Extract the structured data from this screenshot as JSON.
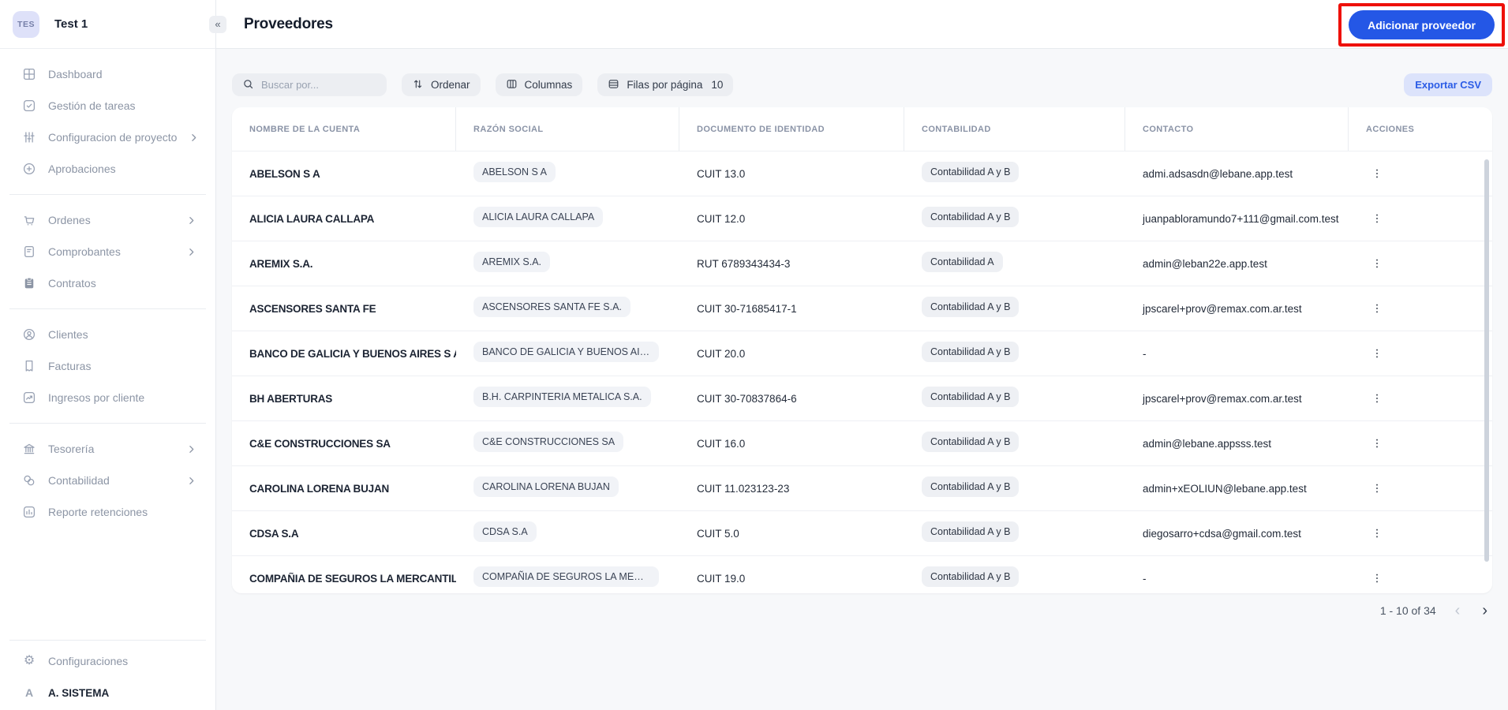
{
  "workspace": {
    "badge": "TES",
    "name": "Test 1"
  },
  "sidebar": {
    "sections": [
      {
        "items": [
          {
            "label": "Dashboard",
            "icon": "dashboard-icon",
            "expandable": false
          },
          {
            "label": "Gestión de tareas",
            "icon": "task-check-icon",
            "expandable": false
          },
          {
            "label": "Configuracion de proyecto",
            "icon": "sliders-icon",
            "expandable": true
          },
          {
            "label": "Aprobaciones",
            "icon": "plus-circle-icon",
            "expandable": false
          }
        ]
      },
      {
        "items": [
          {
            "label": "Ordenes",
            "icon": "cart-icon",
            "expandable": true
          },
          {
            "label": "Comprobantes",
            "icon": "document-icon",
            "expandable": true
          },
          {
            "label": "Contratos",
            "icon": "clipboard-icon",
            "expandable": false
          }
        ]
      },
      {
        "items": [
          {
            "label": "Clientes",
            "icon": "user-circle-icon",
            "expandable": false
          },
          {
            "label": "Facturas",
            "icon": "invoice-icon",
            "expandable": false
          },
          {
            "label": "Ingresos por cliente",
            "icon": "chart-line-icon",
            "expandable": false
          }
        ]
      },
      {
        "items": [
          {
            "label": "Tesorería",
            "icon": "bank-icon",
            "expandable": true
          },
          {
            "label": "Contabilidad",
            "icon": "coins-icon",
            "expandable": true
          },
          {
            "label": "Reporte retenciones",
            "icon": "bar-chart-icon",
            "expandable": false
          }
        ]
      }
    ],
    "footer": [
      {
        "label": "Configuraciones",
        "icon": "gear-icon",
        "expandable": false
      },
      {
        "label": "A. SISTEMA",
        "icon": "avatar-a-icon",
        "expandable": false,
        "user": true
      }
    ]
  },
  "header": {
    "collapse_icon": "«",
    "title": "Proveedores",
    "add_button_label": "Adicionar proveedor"
  },
  "toolbar": {
    "search_placeholder": "Buscar por...",
    "sort_label": "Ordenar",
    "columns_label": "Columnas",
    "rows_per_page_label": "Filas por página",
    "rows_per_page_value": "10",
    "export_label": "Exportar CSV"
  },
  "table": {
    "columns": [
      "Nombre de la cuenta",
      "Razón social",
      "Documento de identidad",
      "Contabilidad",
      "Contacto",
      "Acciones"
    ],
    "rows": [
      {
        "nombre": "ABELSON S A",
        "razon": "ABELSON S A",
        "documento": "CUIT 13.0",
        "contabilidad": "Contabilidad A y B",
        "contacto": "admi.adsasdn@lebane.app.test"
      },
      {
        "nombre": "ALICIA LAURA CALLAPA",
        "razon": "ALICIA LAURA CALLAPA",
        "documento": "CUIT 12.0",
        "contabilidad": "Contabilidad A y B",
        "contacto": "juanpabloramundo7+111@gmail.com.test"
      },
      {
        "nombre": "AREMIX S.A.",
        "razon": "AREMIX S.A.",
        "documento": "RUT 6789343434-3",
        "contabilidad": "Contabilidad A",
        "contacto": "admin@leban22e.app.test"
      },
      {
        "nombre": "ASCENSORES SANTA FE",
        "razon": "ASCENSORES SANTA FE S.A.",
        "documento": "CUIT 30-71685417-1",
        "contabilidad": "Contabilidad A y B",
        "contacto": "jpscarel+prov@remax.com.ar.test"
      },
      {
        "nombre": "BANCO DE GALICIA Y BUENOS AIRES S A U",
        "razon": "BANCO DE GALICIA Y BUENOS AIRES ...",
        "documento": "CUIT 20.0",
        "contabilidad": "Contabilidad A y B",
        "contacto": "-"
      },
      {
        "nombre": "BH ABERTURAS",
        "razon": "B.H. CARPINTERIA METALICA S.A.",
        "documento": "CUIT 30-70837864-6",
        "contabilidad": "Contabilidad A y B",
        "contacto": "jpscarel+prov@remax.com.ar.test"
      },
      {
        "nombre": "C&E CONSTRUCCIONES SA",
        "razon": "C&E CONSTRUCCIONES SA",
        "documento": "CUIT 16.0",
        "contabilidad": "Contabilidad A y B",
        "contacto": "admin@lebane.appsss.test"
      },
      {
        "nombre": "CAROLINA LORENA BUJAN",
        "razon": "CAROLINA LORENA BUJAN",
        "documento": "CUIT 11.023123-23",
        "contabilidad": "Contabilidad A y B",
        "contacto": "admin+xEOLIUN@lebane.app.test"
      },
      {
        "nombre": "CDSA S.A",
        "razon": "CDSA S.A",
        "documento": "CUIT 5.0",
        "contabilidad": "Contabilidad A y B",
        "contacto": "diegosarro+cdsa@gmail.com.test"
      },
      {
        "nombre": "COMPAÑIA DE SEGUROS LA MERCANTIL AND",
        "razon": "COMPAÑIA DE SEGUROS LA MERCAN...",
        "documento": "CUIT 19.0",
        "contabilidad": "Contabilidad A y B",
        "contacto": "-"
      }
    ]
  },
  "pagination": {
    "range_label": "1 - 10 of 34",
    "prev_icon": "‹",
    "next_icon": "›"
  },
  "colors": {
    "accent_blue": "#2457e6",
    "annotation_red": "#ee1009",
    "export_pill_bg": "#dce3fb",
    "export_pill_text": "#2b5ce6",
    "workspace_badge_bg": "#dee1f9",
    "content_bg": "#f7f8fa",
    "chip_bg": "#f1f3f7"
  }
}
